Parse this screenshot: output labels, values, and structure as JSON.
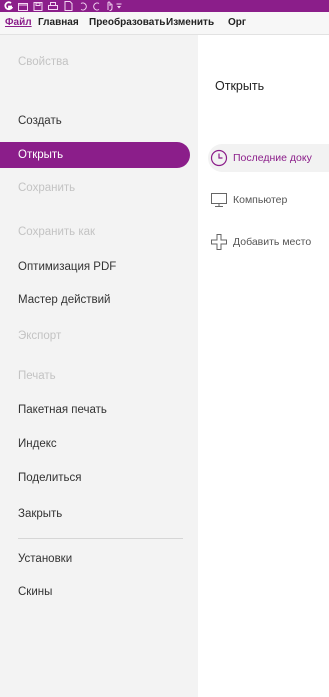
{
  "colors": {
    "accent": "#8b1e8a"
  },
  "title_bar": {
    "icons": [
      "app-logo-icon",
      "open-folder-icon",
      "save-icon",
      "print-icon",
      "new-doc-icon",
      "undo-icon",
      "redo-icon",
      "hand-tool-icon",
      "dropdown-icon"
    ]
  },
  "ribbon": {
    "tabs": [
      "Файл",
      "Главная",
      "Преобразовать",
      "Изменить",
      "Орг"
    ]
  },
  "left_menu": {
    "items": [
      {
        "label": "Свойства",
        "state": "disabled"
      },
      {
        "label": "Создать",
        "state": "normal"
      },
      {
        "label": "Открыть",
        "state": "selected"
      },
      {
        "label": "Сохранить",
        "state": "disabled"
      },
      {
        "label": "Сохранить как",
        "state": "disabled"
      },
      {
        "label": "Оптимизация PDF",
        "state": "normal"
      },
      {
        "label": "Мастер действий",
        "state": "normal"
      },
      {
        "label": "Экспорт",
        "state": "disabled"
      },
      {
        "label": "Печать",
        "state": "disabled"
      },
      {
        "label": "Пакетная печать",
        "state": "normal"
      },
      {
        "label": "Индекс",
        "state": "normal"
      },
      {
        "label": "Поделиться",
        "state": "normal"
      },
      {
        "label": "Закрыть",
        "state": "normal"
      },
      {
        "label": "Установки",
        "state": "normal"
      },
      {
        "label": "Скины",
        "state": "normal"
      }
    ]
  },
  "main": {
    "heading": "Открыть",
    "options": [
      {
        "label": "Последние доку",
        "icon": "clock-icon"
      },
      {
        "label": "Компьютер",
        "icon": "computer-icon"
      },
      {
        "label": "Добавить место",
        "icon": "add-place-icon"
      }
    ]
  }
}
